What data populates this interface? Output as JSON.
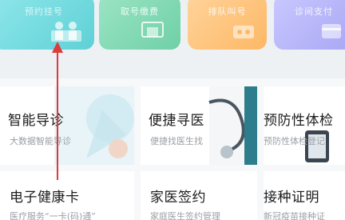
{
  "quick_actions": [
    {
      "label": "预约挂号",
      "icon": "doctor-icon",
      "color": "#6fd8dc"
    },
    {
      "label": "取号缴费",
      "icon": "card-icon",
      "color": "#7fd6ae"
    },
    {
      "label": "排队叫号",
      "icon": "queue-icon",
      "color": "#ffc27a"
    },
    {
      "label": "诊间支付",
      "icon": "pay-icon",
      "color": "#b3b1f7"
    }
  ],
  "services": [
    {
      "title": "智能导诊",
      "subtitle": "大数据智能导诊"
    },
    {
      "title": "便捷寻医",
      "subtitle": "便捷找医生找"
    },
    {
      "title": "预防性体检",
      "subtitle": "预防性体检登记"
    },
    {
      "title": "电子健康卡",
      "subtitle": "医疗服务“一卡(码)通”"
    },
    {
      "title": "家医签约",
      "subtitle": "家庭医生签约管理"
    },
    {
      "title": "接种证明",
      "subtitle": "新冠疫苗接种证"
    }
  ],
  "annotation_color": "#e03a3a"
}
